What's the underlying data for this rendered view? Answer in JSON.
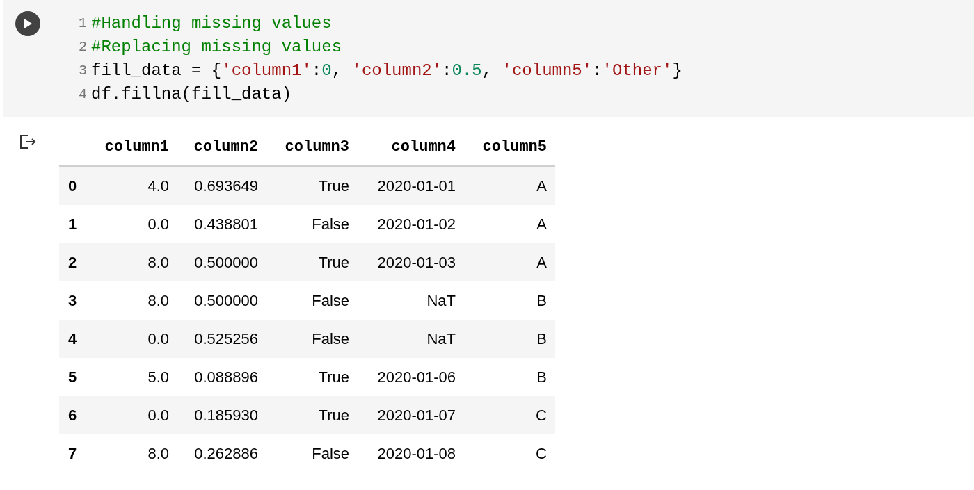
{
  "code_cell": {
    "lines": [
      {
        "number": "1",
        "tokens": [
          {
            "kind": "comment",
            "text": "#Handling missing values"
          }
        ]
      },
      {
        "number": "2",
        "tokens": [
          {
            "kind": "comment",
            "text": "#Replacing missing values"
          }
        ]
      },
      {
        "number": "3",
        "tokens": [
          {
            "kind": "plain",
            "text": "fill_data = {"
          },
          {
            "kind": "string",
            "text": "'column1'"
          },
          {
            "kind": "plain",
            "text": ":"
          },
          {
            "kind": "number",
            "text": "0"
          },
          {
            "kind": "plain",
            "text": ", "
          },
          {
            "kind": "string",
            "text": "'column2'"
          },
          {
            "kind": "plain",
            "text": ":"
          },
          {
            "kind": "number",
            "text": "0.5"
          },
          {
            "kind": "plain",
            "text": ", "
          },
          {
            "kind": "string",
            "text": "'column5'"
          },
          {
            "kind": "plain",
            "text": ":"
          },
          {
            "kind": "string",
            "text": "'Other'"
          },
          {
            "kind": "plain",
            "text": "}"
          }
        ]
      },
      {
        "number": "4",
        "tokens": [
          {
            "kind": "plain",
            "text": "df.fillna(fill_data)"
          }
        ]
      }
    ]
  },
  "output": {
    "table": {
      "columns": [
        "column1",
        "column2",
        "column3",
        "column4",
        "column5"
      ],
      "rows": [
        {
          "index": "0",
          "cells": [
            "4.0",
            "0.693649",
            "True",
            "2020-01-01",
            "A"
          ]
        },
        {
          "index": "1",
          "cells": [
            "0.0",
            "0.438801",
            "False",
            "2020-01-02",
            "A"
          ]
        },
        {
          "index": "2",
          "cells": [
            "8.0",
            "0.500000",
            "True",
            "2020-01-03",
            "A"
          ]
        },
        {
          "index": "3",
          "cells": [
            "8.0",
            "0.500000",
            "False",
            "NaT",
            "B"
          ]
        },
        {
          "index": "4",
          "cells": [
            "0.0",
            "0.525256",
            "False",
            "NaT",
            "B"
          ]
        },
        {
          "index": "5",
          "cells": [
            "5.0",
            "0.088896",
            "True",
            "2020-01-06",
            "B"
          ]
        },
        {
          "index": "6",
          "cells": [
            "0.0",
            "0.185930",
            "True",
            "2020-01-07",
            "C"
          ]
        },
        {
          "index": "7",
          "cells": [
            "8.0",
            "0.262886",
            "False",
            "2020-01-08",
            "C"
          ]
        }
      ]
    }
  }
}
